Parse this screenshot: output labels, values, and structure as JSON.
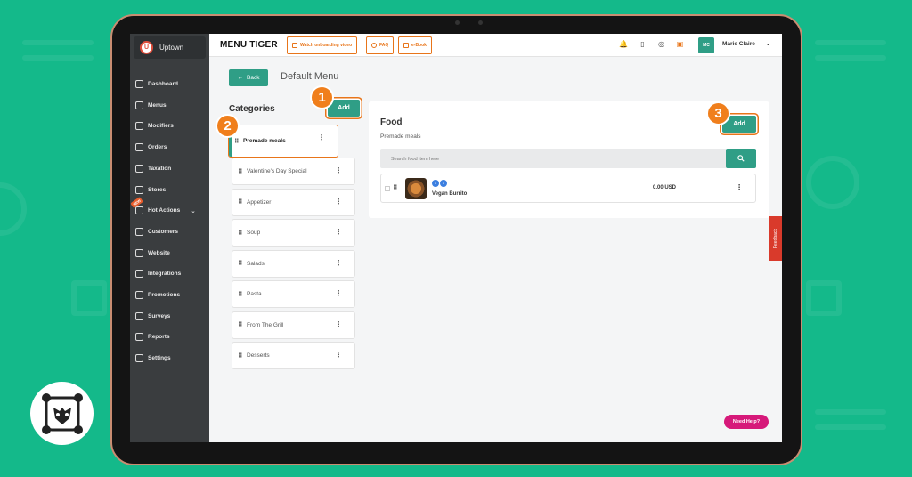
{
  "brand": {
    "name": "Uptown"
  },
  "sidebar": {
    "items": [
      {
        "label": "Dashboard",
        "icon": "home-icon"
      },
      {
        "label": "Menus",
        "icon": "menu-book-icon"
      },
      {
        "label": "Modifiers",
        "icon": "modifiers-icon"
      },
      {
        "label": "Orders",
        "icon": "orders-icon"
      },
      {
        "label": "Taxation",
        "icon": "taxation-icon"
      },
      {
        "label": "Stores",
        "icon": "store-icon"
      },
      {
        "label": "Hot Actions",
        "icon": "hot-actions-icon",
        "new_badge": "NEW"
      },
      {
        "label": "Customers",
        "icon": "customers-icon"
      },
      {
        "label": "Website",
        "icon": "website-icon"
      },
      {
        "label": "Integrations",
        "icon": "integrations-icon"
      },
      {
        "label": "Promotions",
        "icon": "promotions-icon"
      },
      {
        "label": "Surveys",
        "icon": "surveys-icon"
      },
      {
        "label": "Reports",
        "icon": "reports-icon"
      },
      {
        "label": "Settings",
        "icon": "settings-icon"
      }
    ]
  },
  "topbar": {
    "logo": "MENU TIGER",
    "onboarding_label": "Watch onboarding video",
    "faq_label": "FAQ",
    "ebook_label": "e-Book",
    "user_initials": "MC",
    "user_name": "Marie Claire"
  },
  "page": {
    "back_label": "Back",
    "title": "Default Menu",
    "categories_title": "Categories",
    "add_category_label": "Add",
    "categories": [
      "Premade meals",
      "Valentine's Day Special",
      "Appetizer",
      "Soup",
      "Salads",
      "Pasta",
      "From The Grill",
      "Desserts"
    ]
  },
  "food": {
    "title": "Food",
    "subtitle": "Premade meals",
    "add_label": "Add",
    "search_placeholder": "Search food item here",
    "items": [
      {
        "name": "Vegan Burrito",
        "price": "0.00 USD"
      }
    ]
  },
  "feedback_label": "Feedback",
  "need_help_label": "Need Help?",
  "steps": [
    "1",
    "2",
    "3"
  ],
  "colors": {
    "accent": "#2f9e86",
    "highlight": "#f07f1c",
    "background": "#14b98a",
    "help": "#d6197a"
  }
}
